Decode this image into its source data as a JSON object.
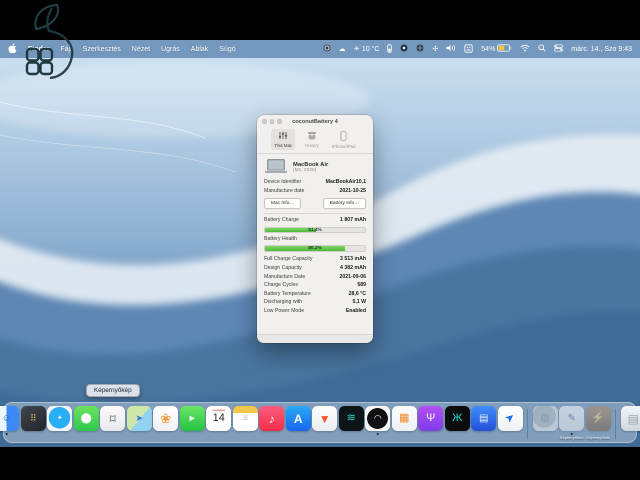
{
  "colors": {
    "accent_green": "#4fb83c",
    "battery_yellow": "#f5c933",
    "menubar_blue": "#6088b2",
    "black_band": "#000000"
  },
  "menu_bar": {
    "apple_icon": "apple-logo",
    "items": [
      "Finder",
      "Fájl",
      "Szerkesztés",
      "Nézet",
      "Ugrás",
      "Ablak",
      "Súgó"
    ],
    "status_items": [
      {
        "name": "app-ring-icon",
        "shape": "ring"
      },
      {
        "name": "cloud-icon",
        "glyph": "☁"
      },
      {
        "name": "weather-item",
        "glyph": "☀",
        "text": "10 °C"
      },
      {
        "name": "gauge-icon",
        "shape": "gauge"
      },
      {
        "name": "record-icon",
        "shape": "dot-circle"
      },
      {
        "name": "globe-icon",
        "shape": "dark-circle"
      },
      {
        "name": "fan-icon",
        "glyph": "✣"
      },
      {
        "name": "volume-icon",
        "shape": "speaker"
      },
      {
        "name": "input-source-icon",
        "shape": "input-box"
      },
      {
        "name": "battery-item",
        "text": "54%",
        "shape": "battery"
      },
      {
        "name": "wifi-icon",
        "shape": "wifi"
      },
      {
        "name": "spotlight-icon",
        "shape": "magnifier"
      },
      {
        "name": "control-center-icon",
        "shape": "control-center"
      },
      {
        "name": "clock-item",
        "text": "márc. 14., Szo 9:43"
      }
    ]
  },
  "window": {
    "title": "coconutBattery 4",
    "tabs": [
      {
        "label": "This Mac",
        "icon": "sliders",
        "selected": true
      },
      {
        "label": "History",
        "icon": "archive",
        "selected": false
      },
      {
        "label": "iPhone/iPad",
        "icon": "phone",
        "selected": false
      }
    ],
    "device": {
      "name": "MacBook Air",
      "model": "(M1, 2020)"
    },
    "info_rows": [
      {
        "label": "Device Identifier",
        "value": "MacBookAir10,1"
      },
      {
        "label": "Manufacture date",
        "value": "2021-10-25"
      }
    ],
    "buttons": [
      "Mac Info…",
      "Battery Info…"
    ],
    "charge": {
      "label": "Battery Charge",
      "value": "1 807 mAh",
      "percent_label": "51,4%",
      "fill": 51.4
    },
    "health": {
      "label": "Battery Health",
      "percent_label": "80,2%",
      "fill": 80.2
    },
    "detail_rows": [
      {
        "label": "Full Charge Capacity",
        "value": "3 513 mAh"
      },
      {
        "label": "Design Capacity",
        "value": "4 382 mAh"
      },
      {
        "label": "Manufacture Date",
        "value": "2021-09-06"
      },
      {
        "label": "Charge Cycles",
        "value": "589"
      },
      {
        "label": "Battery Temperature",
        "value": "28,6 °C"
      },
      {
        "label": "Discharging with",
        "value": "5,1 W"
      },
      {
        "label": "Low Power Mode",
        "value": "Enabled"
      }
    ]
  },
  "tooltip": "Képernyőkép",
  "dock": {
    "items": [
      {
        "name": "finder",
        "bg": "linear-gradient(90deg,#eef6fd 0 50%,#3b8af5 50% 100%)",
        "glyph": "☺",
        "color": "#1b5fb8",
        "size": 10,
        "dot": true
      },
      {
        "name": "launchpad",
        "bg": "linear-gradient(145deg,#41454e,#22252b)",
        "glyph": "⠿",
        "color": "#e8c05a",
        "size": 9
      },
      {
        "name": "safari",
        "bg": "radial-gradient(circle at 50% 47%,#27aef5 0 58%,#f4f6f8 60%)",
        "glyph": "✦",
        "color": "#ffffff",
        "size": 7
      },
      {
        "name": "messages",
        "bg": "linear-gradient(180deg,#6ce35f,#2cc84d)",
        "glyph": "⬤",
        "color": "#ffffff",
        "size": 10
      },
      {
        "name": "screenshot",
        "bg": "linear-gradient(180deg,#fbfbfc,#e7e9ed)",
        "glyph": "⌑",
        "color": "#4a4d55",
        "size": 12
      },
      {
        "name": "maps",
        "bg": "linear-gradient(130deg,#cfe8a9 0 52%,#92d2f1 52%)",
        "glyph": "➤",
        "color": "#2e72e8",
        "size": 9
      },
      {
        "name": "photos",
        "bg": "linear-gradient(180deg,#ffffff,#f0f1f4)",
        "glyph": "❀",
        "color": "#f09a38",
        "size": 13
      },
      {
        "name": "facetime",
        "bg": "linear-gradient(180deg,#6ae564,#23c343)",
        "glyph": "►",
        "color": "#ffffff",
        "size": 9
      },
      {
        "name": "calendar",
        "bg": "#ffffff",
        "cal_top": "szombat",
        "cal_num": "14"
      },
      {
        "name": "notes",
        "bg": "linear-gradient(180deg,#f6c54b 0 27%,#ffffff 27%)",
        "glyph": "≡",
        "color": "#c2c2c2",
        "size": 10
      },
      {
        "name": "music",
        "bg": "linear-gradient(180deg,#fc5c7d,#f52d48)",
        "glyph": "♪",
        "color": "#ffffff",
        "size": 12
      },
      {
        "name": "app-store",
        "bg": "linear-gradient(180deg,#2aa9f4,#1667f0)",
        "glyph": "A",
        "color": "#ffffff",
        "size": 12,
        "bold": true
      },
      {
        "name": "brave",
        "bg": "linear-gradient(180deg,#fdfdfd,#eceef1)",
        "glyph": "▼",
        "color": "#fb542b",
        "size": 12
      },
      {
        "name": "audio-waves-app",
        "bg": "#0d1518",
        "glyph": "≋",
        "color": "#27e0c8",
        "size": 11
      },
      {
        "name": "wifi-analyzer",
        "bg": "radial-gradient(circle at 50% 50%,#101114 0 58%,#f5f6f8 60%)",
        "glyph": "◠",
        "color": "#ffffff",
        "size": 9,
        "dot": true
      },
      {
        "name": "calculator",
        "bg": "linear-gradient(180deg,#fdfdfd,#eef0f2)",
        "glyph": "▦",
        "color": "#ef8b2d",
        "size": 11
      },
      {
        "name": "podcasts",
        "bg": "linear-gradient(180deg,#b14ff2,#7e3ce8)",
        "glyph": "Ψ",
        "color": "#ffffff",
        "size": 11
      },
      {
        "name": "butterfly-app",
        "bg": "#0b0c0e",
        "glyph": "Ж",
        "color": "#2bd8c8",
        "size": 11
      },
      {
        "name": "wallet-app",
        "bg": "linear-gradient(180deg,#3f8df8,#2351d8)",
        "glyph": "▤",
        "color": "#e8f0ff",
        "size": 10
      },
      {
        "name": "paper-plane-app",
        "bg": "linear-gradient(180deg,#ffffff,#eef1f5)",
        "glyph": "➤",
        "color": "#1d6ff2",
        "size": 11,
        "rotate": -40
      },
      {
        "separator": true
      },
      {
        "name": "sphere-app",
        "bg": "radial-gradient(circle at 45% 40%,#b9bfc7 0 56%,#e8eaee 58%)",
        "glyph": "◍",
        "color": "#8d949c",
        "size": 11,
        "dim": true
      },
      {
        "name": "screenshot-file",
        "bg": "linear-gradient(180deg,#fdfdfe,#e9ecf0)",
        "glyph": "✎",
        "color": "#3a77e0",
        "size": 10,
        "dim": true,
        "label": "Képernyőfotó",
        "dot": true
      },
      {
        "name": "lightning-app",
        "bg": "linear-gradient(180deg,#c98a4a,#8e5a28)",
        "glyph": "⚡",
        "color": "#ffd65c",
        "size": 11,
        "dim": true,
        "label": "Képernyőfotó"
      },
      {
        "separator": true
      },
      {
        "name": "trash",
        "bg": "linear-gradient(180deg,#f4f6f9,#cfd6dd)",
        "glyph": "▤",
        "color": "#9aa3ad",
        "size": 12
      }
    ]
  }
}
